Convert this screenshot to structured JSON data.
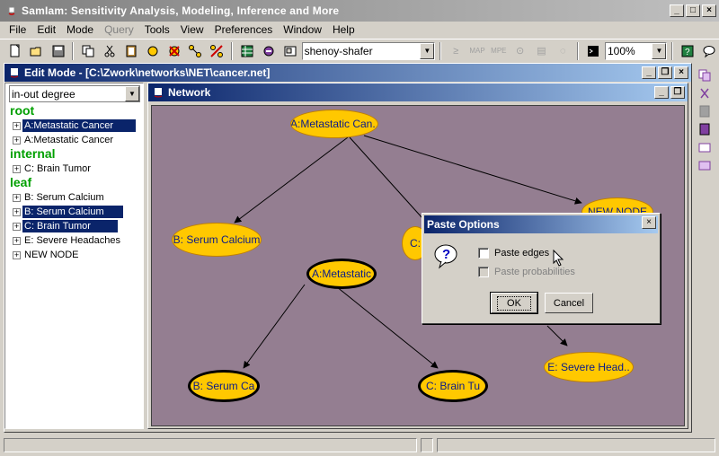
{
  "app": {
    "title": "SamIam: Sensitivity Analysis, Modeling, Inference and More"
  },
  "menu": {
    "items": [
      {
        "label": "File",
        "enabled": true
      },
      {
        "label": "Edit",
        "enabled": true
      },
      {
        "label": "Mode",
        "enabled": true
      },
      {
        "label": "Query",
        "enabled": false
      },
      {
        "label": "Tools",
        "enabled": true
      },
      {
        "label": "View",
        "enabled": true
      },
      {
        "label": "Preferences",
        "enabled": true
      },
      {
        "label": "Window",
        "enabled": true
      },
      {
        "label": "Help",
        "enabled": true
      }
    ]
  },
  "toolbar": {
    "algorithm": "shenoy-shafer",
    "zoom": "100%"
  },
  "edit_window": {
    "title": "Edit Mode - [C:\\Zwork\\networks\\NET\\cancer.net]"
  },
  "left_panel": {
    "sort_mode": "in-out degree",
    "groups": {
      "root": "root",
      "internal": "internal",
      "leaf": "leaf"
    },
    "items": [
      {
        "label": "A:Metastatic Cancer",
        "selected": true
      },
      {
        "label": "A:Metastatic Cancer",
        "selected": false
      },
      {
        "label": "C:  Brain Tumor",
        "selected": false
      },
      {
        "label": "B: Serum Calcium",
        "selected": false
      },
      {
        "label": "B: Serum Calcium",
        "selected": true
      },
      {
        "label": "C:  Brain Tumor",
        "selected": true
      },
      {
        "label": "E: Severe Headaches",
        "selected": false
      },
      {
        "label": "NEW NODE",
        "selected": false
      }
    ]
  },
  "network_window": {
    "title": "Network",
    "nodes": [
      {
        "label": "A:Metastatic Can..",
        "selected": false
      },
      {
        "label": "B: Serum Calcium",
        "selected": false
      },
      {
        "label": "C:",
        "selected": false
      },
      {
        "label": "NEW NODE",
        "selected": false
      },
      {
        "label": "A:Metastatic",
        "selected": true
      },
      {
        "label": "E: Severe Head..",
        "selected": false
      },
      {
        "label": "B: Serum Ca",
        "selected": true
      },
      {
        "label": "C:  Brain Tu",
        "selected": true
      }
    ]
  },
  "dialog": {
    "title": "Paste Options",
    "paste_edges": {
      "label": "Paste edges",
      "checked": false,
      "enabled": true
    },
    "paste_probabilities": {
      "label": "Paste probabilities",
      "checked": false,
      "enabled": false
    },
    "ok": "OK",
    "cancel": "Cancel"
  },
  "colors": {
    "canvas": "#947e91",
    "node_fill": "#ffc800",
    "node_text": "#0a1a8a",
    "title_active": "#0a246a",
    "group_label": "#00a000"
  }
}
